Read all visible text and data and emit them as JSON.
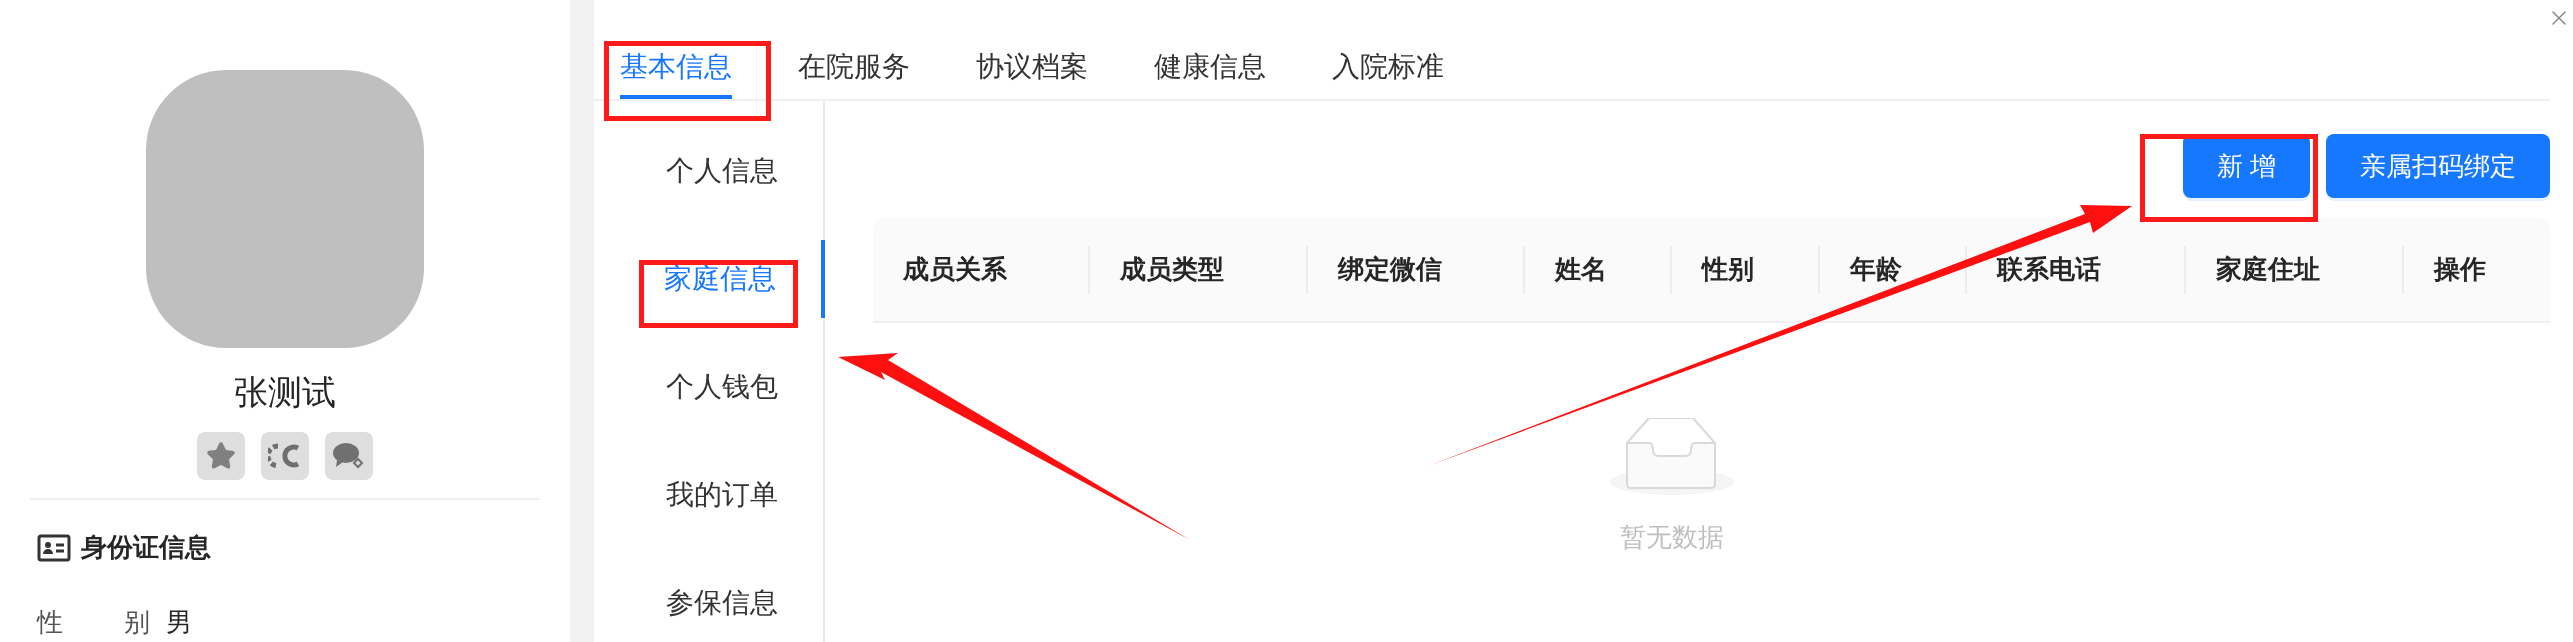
{
  "profile": {
    "name": "张测试"
  },
  "id_section": {
    "title": "身份证信息",
    "fields": [
      {
        "label": "性 别",
        "value": "男"
      }
    ]
  },
  "tabs": [
    {
      "label": "基本信息",
      "selected": true
    },
    {
      "label": "在院服务",
      "selected": false
    },
    {
      "label": "协议档案",
      "selected": false
    },
    {
      "label": "健康信息",
      "selected": false
    },
    {
      "label": "入院标准",
      "selected": false
    }
  ],
  "sidebar": {
    "items": [
      {
        "label": "个人信息",
        "selected": false
      },
      {
        "label": "家庭信息",
        "selected": true
      },
      {
        "label": "个人钱包",
        "selected": false
      },
      {
        "label": "我的订单",
        "selected": false
      },
      {
        "label": "参保信息",
        "selected": false
      }
    ]
  },
  "actions": [
    "新 增",
    "亲属扫码绑定"
  ],
  "table": {
    "columns": [
      "成员关系",
      "成员类型",
      "绑定微信",
      "姓名",
      "性别",
      "年龄",
      "联系电话",
      "家庭住址",
      "操作"
    ],
    "empty_text": "暂无数据"
  }
}
